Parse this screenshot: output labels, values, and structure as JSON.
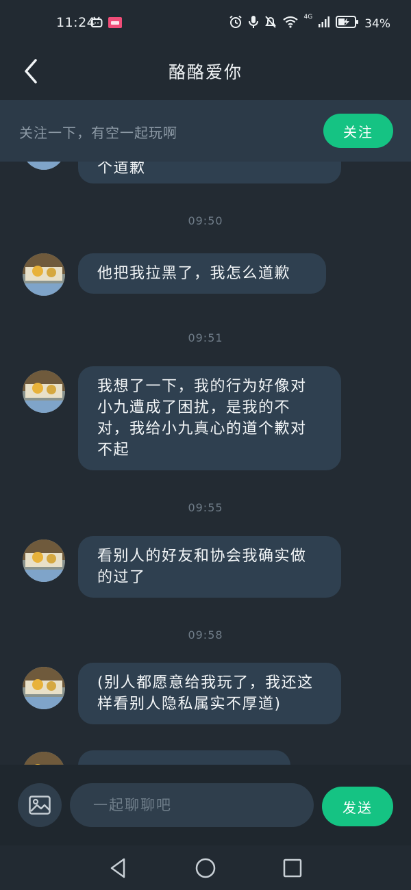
{
  "status_bar": {
    "time": "11:24",
    "battery": "34%",
    "network": "4G"
  },
  "header": {
    "title": "酪酪爱你"
  },
  "follow_bar": {
    "text": "关注一下，有空一起玩啊",
    "button_label": "关注"
  },
  "messages": [
    {
      "text": "个道歉"
    },
    {
      "time": "09:50",
      "text": "他把我拉黑了，我怎么道歉"
    },
    {
      "time": "09:51",
      "text": "我想了一下，我的行为好像对小九遭成了困扰，是我的不对，我给小九真心的道个歉对不起"
    },
    {
      "time": "09:55",
      "text": "看别人的好友和协会我确实做的过了"
    },
    {
      "time": "09:58",
      "text": "(别人都愿意给我玩了，我还这样看别人隐私属实不厚道)"
    }
  ],
  "input_bar": {
    "placeholder": "一起聊聊吧",
    "send_label": "发送"
  },
  "colors": {
    "accent": "#15c383",
    "bubble": "#2f4050",
    "background": "#232b33"
  }
}
